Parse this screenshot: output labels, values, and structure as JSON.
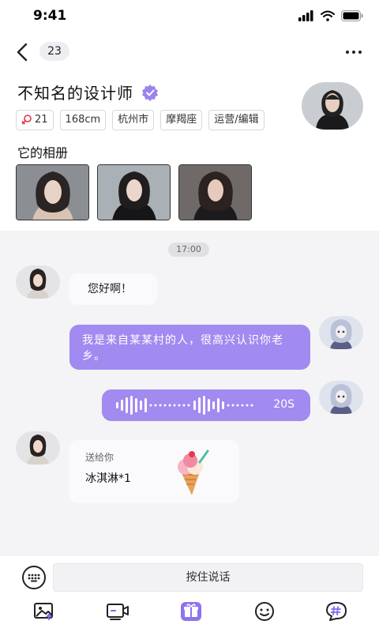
{
  "status": {
    "time": "9:41"
  },
  "nav": {
    "unread_count": "23"
  },
  "profile": {
    "name": "不知名的设计师",
    "tags": [
      "21",
      "168cm",
      "杭州市",
      "摩羯座",
      "运营/编辑"
    ],
    "album_title": "它的相册"
  },
  "chat": {
    "timestamp": "17:00",
    "messages": [
      {
        "side": "left",
        "type": "text",
        "text": "您好啊！"
      },
      {
        "side": "right",
        "type": "text",
        "text": "我是来自某某村的人，很高兴认识你老乡。"
      },
      {
        "side": "right",
        "type": "voice",
        "duration": "20S"
      },
      {
        "side": "left",
        "type": "gift",
        "label": "送给你",
        "name": "冰淇淋*1"
      }
    ]
  },
  "input": {
    "hold_to_talk": "按住说话"
  },
  "toolbar": {
    "icons": [
      "image-upload-icon",
      "video-call-icon",
      "gift-icon",
      "emoji-icon",
      "topic-icon"
    ]
  },
  "colors": {
    "accent": "#a18af0",
    "gift_icon": "#8f72ec",
    "female_symbol": "#e0344a"
  }
}
